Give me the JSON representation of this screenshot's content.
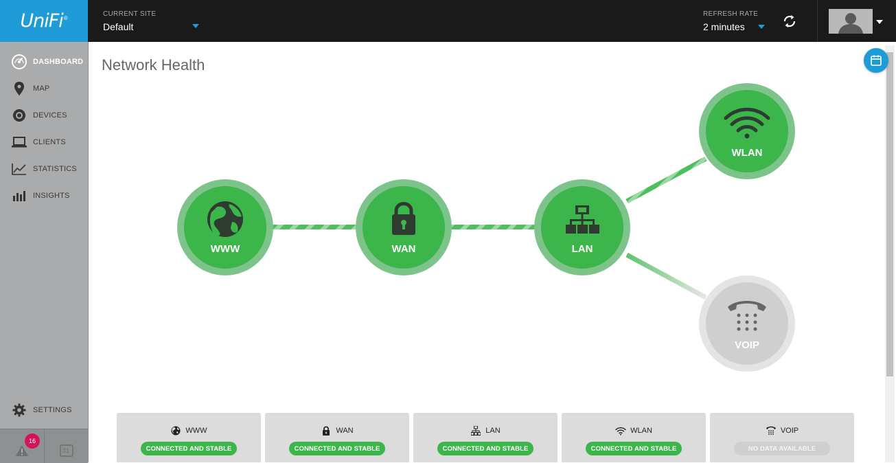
{
  "app": {
    "logo": "UniFi",
    "logo_mark": "®"
  },
  "sidebar": {
    "items": [
      {
        "label": "Dashboard",
        "icon": "dashboard-gauge-icon",
        "active": true
      },
      {
        "label": "Map",
        "icon": "map-pin-icon"
      },
      {
        "label": "Devices",
        "icon": "device-circle-icon"
      },
      {
        "label": "Clients",
        "icon": "laptop-icon"
      },
      {
        "label": "Statistics",
        "icon": "line-chart-icon"
      },
      {
        "label": "Insights",
        "icon": "bar-chart-icon"
      }
    ],
    "settings": {
      "label": "Settings",
      "icon": "gear-icon"
    },
    "alerts": {
      "count": "16",
      "icon": "warning-icon"
    },
    "calendar": {
      "day": "31",
      "icon": "calendar-icon"
    }
  },
  "topbar": {
    "site_label": "CURRENT SITE",
    "site_value": "Default",
    "rate_label": "REFRESH RATE",
    "rate_value": "2 minutes",
    "refresh_icon": "refresh-icon",
    "user_icon": "user-avatar-icon"
  },
  "main": {
    "title": "Network Health",
    "fab_icon": "calendar-widget-icon"
  },
  "diagram": {
    "nodes": [
      {
        "id": "www",
        "label": "WWW",
        "status": "ok"
      },
      {
        "id": "wan",
        "label": "WAN",
        "status": "ok"
      },
      {
        "id": "lan",
        "label": "LAN",
        "status": "ok"
      },
      {
        "id": "wlan",
        "label": "WLAN",
        "status": "ok"
      },
      {
        "id": "voip",
        "label": "VOIP",
        "status": "none"
      }
    ],
    "colors": {
      "ok": "#3cb54a",
      "ok_ring": "#7dc48a",
      "none": "#cfcfcf",
      "none_ring": "#e4e4e4"
    }
  },
  "cards": [
    {
      "label": "WWW",
      "status": "CONNECTED AND STABLE",
      "state": "ok"
    },
    {
      "label": "WAN",
      "status": "CONNECTED AND STABLE",
      "state": "ok"
    },
    {
      "label": "LAN",
      "status": "CONNECTED AND STABLE",
      "state": "ok"
    },
    {
      "label": "WLAN",
      "status": "CONNECTED AND STABLE",
      "state": "ok"
    },
    {
      "label": "VOIP",
      "status": "NO DATA AVAILABLE",
      "state": "none"
    }
  ]
}
